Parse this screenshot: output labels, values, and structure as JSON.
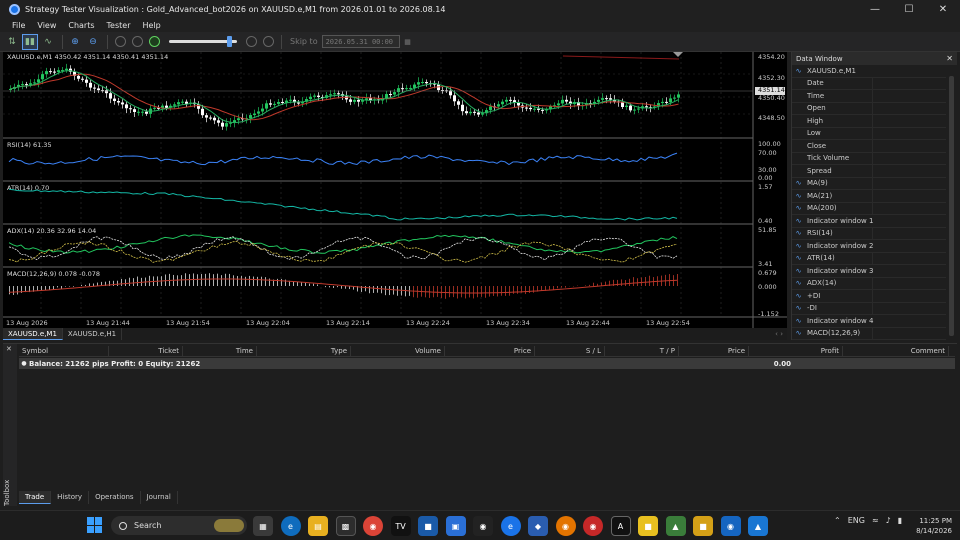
{
  "window": {
    "title": "Strategy Tester Visualization : Gold_Advanced_bot2026 on XAUUSD.e,M1 from 2026.01.01 to 2026.08.14"
  },
  "menu": [
    "File",
    "View",
    "Charts",
    "Tester",
    "Help"
  ],
  "toolbar": {
    "skip_to_label": "Skip to",
    "skip_to_date": "2026.05.31 00:00",
    "speed_level": 0.92
  },
  "chart": {
    "symbol_info": "XAUUSD.e,M1  4350.42 4351.14 4350.41 4351.14",
    "price_labels": [
      "4354.20",
      "4352.30",
      "4351.14",
      "4350.40",
      "4348.50"
    ],
    "time_labels": [
      "13 Aug 2026",
      "13 Aug 21:44",
      "13 Aug 21:54",
      "13 Aug 22:04",
      "13 Aug 22:14",
      "13 Aug 22:24",
      "13 Aug 22:34",
      "13 Aug 22:44",
      "13 Aug 22:54"
    ],
    "rsi": {
      "label": "RSI(14) 61.35",
      "scale": [
        "100.00",
        "70.00",
        "30.00",
        "0.00"
      ]
    },
    "atr": {
      "label": "ATR(14) 0.70",
      "scale": [
        "1.57",
        "0.40"
      ]
    },
    "adx": {
      "label": "ADX(14) 20.36 32.96 14.04",
      "scale": [
        "51.85",
        "3.41"
      ]
    },
    "macd": {
      "label": "MACD(12,26,9) 0.078 -0.078",
      "scale": [
        "0.679",
        "0.000",
        "-1.152"
      ]
    },
    "tabs": [
      "XAUUSD.e,M1",
      "XAUUSD.e,H1"
    ],
    "scroll_arrows": "‹ ›"
  },
  "data_window": {
    "title": "Data Window",
    "rows": [
      {
        "icon": "chart-icon",
        "label": "XAUUSD.e,M1",
        "type": "ind"
      },
      {
        "label": "Date"
      },
      {
        "label": "Time"
      },
      {
        "label": "Open"
      },
      {
        "label": "High"
      },
      {
        "label": "Low"
      },
      {
        "label": "Close"
      },
      {
        "label": "Tick Volume"
      },
      {
        "label": "Spread"
      },
      {
        "icon": "chart-icon",
        "label": "MA(9)"
      },
      {
        "icon": "chart-icon",
        "label": "MA(21)"
      },
      {
        "icon": "chart-icon",
        "label": "MA(200)"
      },
      {
        "icon": "chart-icon",
        "label": "Indicator window 1",
        "type": "ind"
      },
      {
        "icon": "chart-icon",
        "label": "RSI(14)"
      },
      {
        "icon": "chart-icon",
        "label": "Indicator window 2",
        "type": "ind"
      },
      {
        "icon": "chart-icon",
        "label": "ATR(14)"
      },
      {
        "icon": "chart-icon",
        "label": "Indicator window 3",
        "type": "ind"
      },
      {
        "icon": "chart-icon",
        "label": "ADX(14)"
      },
      {
        "icon": "chart-icon",
        "label": "+DI"
      },
      {
        "icon": "chart-icon",
        "label": "-DI"
      },
      {
        "icon": "chart-icon",
        "label": "Indicator window 4",
        "type": "ind"
      },
      {
        "icon": "chart-icon",
        "label": "MACD(12,26,9)"
      }
    ]
  },
  "toolbox": {
    "side_label": "Toolbox",
    "columns": [
      "Symbol",
      "Ticket",
      "Time",
      "Type",
      "Volume",
      "Price",
      "S / L",
      "T / P",
      "Price",
      "Profit",
      "Comment"
    ],
    "balance_text": "Balance: 21262 pips   Profit: 0   Equity: 21262",
    "balance_profit": "0.00",
    "tabs": [
      "Trade",
      "History",
      "Operations",
      "Journal"
    ]
  },
  "taskbar": {
    "search_placeholder": "Search",
    "language": "ENG",
    "time": "11:25 PM",
    "date": "8/14/2026"
  },
  "colors": {
    "bull_candle": "#22c55e",
    "bear_candle": "#ffffff",
    "ma_red": "#c0392b",
    "ma_green": "#27ae60",
    "rsi_line": "#3b82f6",
    "atr_line": "#14b8a6",
    "accent": "#5c9ded"
  }
}
